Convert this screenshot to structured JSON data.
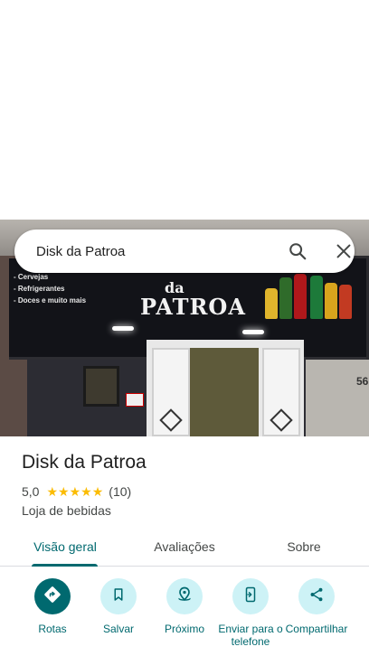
{
  "search": {
    "query": "Disk da Patroa"
  },
  "photo": {
    "sign_items": [
      "- Cervejas",
      "- Refrigerantes",
      "- Doces e muito mais"
    ],
    "sign_da": "da",
    "sign_name": "PATROA",
    "house_number": "56"
  },
  "place": {
    "name": "Disk da Patroa",
    "rating": "5,0",
    "stars": 5,
    "review_count": "(10)",
    "category": "Loja de bebidas"
  },
  "tabs": [
    {
      "label": "Visão geral",
      "active": true
    },
    {
      "label": "Avaliações",
      "active": false
    },
    {
      "label": "Sobre",
      "active": false
    }
  ],
  "actions": [
    {
      "label": "Rotas",
      "icon": "directions-icon"
    },
    {
      "label": "Salvar",
      "icon": "bookmark-icon"
    },
    {
      "label": "Próximo",
      "icon": "nearby-icon"
    },
    {
      "label": "Enviar para o telefone",
      "icon": "send-to-phone-icon"
    },
    {
      "label": "Compartilhar",
      "icon": "share-icon"
    }
  ],
  "colors": {
    "accent": "#00696f",
    "accent_light": "#cdf2f6",
    "star": "#fbbc04"
  }
}
